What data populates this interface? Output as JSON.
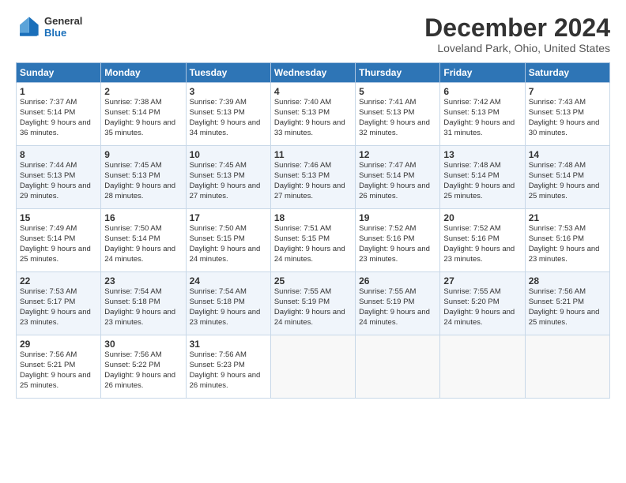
{
  "logo": {
    "line1": "General",
    "line2": "Blue"
  },
  "header": {
    "title": "December 2024",
    "location": "Loveland Park, Ohio, United States"
  },
  "weekdays": [
    "Sunday",
    "Monday",
    "Tuesday",
    "Wednesday",
    "Thursday",
    "Friday",
    "Saturday"
  ],
  "weeks": [
    [
      {
        "day": "1",
        "sunrise": "Sunrise: 7:37 AM",
        "sunset": "Sunset: 5:14 PM",
        "daylight": "Daylight: 9 hours and 36 minutes."
      },
      {
        "day": "2",
        "sunrise": "Sunrise: 7:38 AM",
        "sunset": "Sunset: 5:14 PM",
        "daylight": "Daylight: 9 hours and 35 minutes."
      },
      {
        "day": "3",
        "sunrise": "Sunrise: 7:39 AM",
        "sunset": "Sunset: 5:13 PM",
        "daylight": "Daylight: 9 hours and 34 minutes."
      },
      {
        "day": "4",
        "sunrise": "Sunrise: 7:40 AM",
        "sunset": "Sunset: 5:13 PM",
        "daylight": "Daylight: 9 hours and 33 minutes."
      },
      {
        "day": "5",
        "sunrise": "Sunrise: 7:41 AM",
        "sunset": "Sunset: 5:13 PM",
        "daylight": "Daylight: 9 hours and 32 minutes."
      },
      {
        "day": "6",
        "sunrise": "Sunrise: 7:42 AM",
        "sunset": "Sunset: 5:13 PM",
        "daylight": "Daylight: 9 hours and 31 minutes."
      },
      {
        "day": "7",
        "sunrise": "Sunrise: 7:43 AM",
        "sunset": "Sunset: 5:13 PM",
        "daylight": "Daylight: 9 hours and 30 minutes."
      }
    ],
    [
      {
        "day": "8",
        "sunrise": "Sunrise: 7:44 AM",
        "sunset": "Sunset: 5:13 PM",
        "daylight": "Daylight: 9 hours and 29 minutes."
      },
      {
        "day": "9",
        "sunrise": "Sunrise: 7:45 AM",
        "sunset": "Sunset: 5:13 PM",
        "daylight": "Daylight: 9 hours and 28 minutes."
      },
      {
        "day": "10",
        "sunrise": "Sunrise: 7:45 AM",
        "sunset": "Sunset: 5:13 PM",
        "daylight": "Daylight: 9 hours and 27 minutes."
      },
      {
        "day": "11",
        "sunrise": "Sunrise: 7:46 AM",
        "sunset": "Sunset: 5:13 PM",
        "daylight": "Daylight: 9 hours and 27 minutes."
      },
      {
        "day": "12",
        "sunrise": "Sunrise: 7:47 AM",
        "sunset": "Sunset: 5:14 PM",
        "daylight": "Daylight: 9 hours and 26 minutes."
      },
      {
        "day": "13",
        "sunrise": "Sunrise: 7:48 AM",
        "sunset": "Sunset: 5:14 PM",
        "daylight": "Daylight: 9 hours and 25 minutes."
      },
      {
        "day": "14",
        "sunrise": "Sunrise: 7:48 AM",
        "sunset": "Sunset: 5:14 PM",
        "daylight": "Daylight: 9 hours and 25 minutes."
      }
    ],
    [
      {
        "day": "15",
        "sunrise": "Sunrise: 7:49 AM",
        "sunset": "Sunset: 5:14 PM",
        "daylight": "Daylight: 9 hours and 25 minutes."
      },
      {
        "day": "16",
        "sunrise": "Sunrise: 7:50 AM",
        "sunset": "Sunset: 5:14 PM",
        "daylight": "Daylight: 9 hours and 24 minutes."
      },
      {
        "day": "17",
        "sunrise": "Sunrise: 7:50 AM",
        "sunset": "Sunset: 5:15 PM",
        "daylight": "Daylight: 9 hours and 24 minutes."
      },
      {
        "day": "18",
        "sunrise": "Sunrise: 7:51 AM",
        "sunset": "Sunset: 5:15 PM",
        "daylight": "Daylight: 9 hours and 24 minutes."
      },
      {
        "day": "19",
        "sunrise": "Sunrise: 7:52 AM",
        "sunset": "Sunset: 5:16 PM",
        "daylight": "Daylight: 9 hours and 23 minutes."
      },
      {
        "day": "20",
        "sunrise": "Sunrise: 7:52 AM",
        "sunset": "Sunset: 5:16 PM",
        "daylight": "Daylight: 9 hours and 23 minutes."
      },
      {
        "day": "21",
        "sunrise": "Sunrise: 7:53 AM",
        "sunset": "Sunset: 5:16 PM",
        "daylight": "Daylight: 9 hours and 23 minutes."
      }
    ],
    [
      {
        "day": "22",
        "sunrise": "Sunrise: 7:53 AM",
        "sunset": "Sunset: 5:17 PM",
        "daylight": "Daylight: 9 hours and 23 minutes."
      },
      {
        "day": "23",
        "sunrise": "Sunrise: 7:54 AM",
        "sunset": "Sunset: 5:18 PM",
        "daylight": "Daylight: 9 hours and 23 minutes."
      },
      {
        "day": "24",
        "sunrise": "Sunrise: 7:54 AM",
        "sunset": "Sunset: 5:18 PM",
        "daylight": "Daylight: 9 hours and 23 minutes."
      },
      {
        "day": "25",
        "sunrise": "Sunrise: 7:55 AM",
        "sunset": "Sunset: 5:19 PM",
        "daylight": "Daylight: 9 hours and 24 minutes."
      },
      {
        "day": "26",
        "sunrise": "Sunrise: 7:55 AM",
        "sunset": "Sunset: 5:19 PM",
        "daylight": "Daylight: 9 hours and 24 minutes."
      },
      {
        "day": "27",
        "sunrise": "Sunrise: 7:55 AM",
        "sunset": "Sunset: 5:20 PM",
        "daylight": "Daylight: 9 hours and 24 minutes."
      },
      {
        "day": "28",
        "sunrise": "Sunrise: 7:56 AM",
        "sunset": "Sunset: 5:21 PM",
        "daylight": "Daylight: 9 hours and 25 minutes."
      }
    ],
    [
      {
        "day": "29",
        "sunrise": "Sunrise: 7:56 AM",
        "sunset": "Sunset: 5:21 PM",
        "daylight": "Daylight: 9 hours and 25 minutes."
      },
      {
        "day": "30",
        "sunrise": "Sunrise: 7:56 AM",
        "sunset": "Sunset: 5:22 PM",
        "daylight": "Daylight: 9 hours and 26 minutes."
      },
      {
        "day": "31",
        "sunrise": "Sunrise: 7:56 AM",
        "sunset": "Sunset: 5:23 PM",
        "daylight": "Daylight: 9 hours and 26 minutes."
      },
      null,
      null,
      null,
      null
    ]
  ]
}
